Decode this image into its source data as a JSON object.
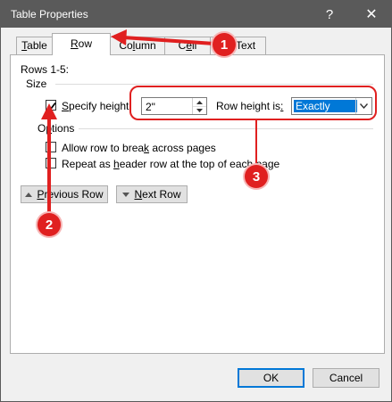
{
  "window": {
    "title": "Table Properties",
    "help_glyph": "?",
    "close_glyph": "✕"
  },
  "tabs": [
    {
      "label": "Table",
      "underline_index": 0
    },
    {
      "label": "Row",
      "underline_index": 0,
      "active": true
    },
    {
      "label": "Column",
      "underline_index": 2
    },
    {
      "label": "Cell",
      "underline_index": 1
    },
    {
      "label": "Alt Text",
      "underline_index": 1
    }
  ],
  "row_tab": {
    "rows_label": "Rows 1-5:",
    "size_group": "Size",
    "specify_height": {
      "label": "Specify height:",
      "checked": true,
      "underline_index": 0
    },
    "height_value": "2\"",
    "row_height_is": {
      "label": "Row height is:",
      "underline_index": 13
    },
    "row_height_mode": "Exactly",
    "options_group": {
      "label": "Options",
      "underline_index": 1
    },
    "allow_break": {
      "label": "Allow row to break across pages",
      "checked": false,
      "underline_index": 17
    },
    "repeat_header": {
      "label": "Repeat as header row at the top of each page",
      "checked": false,
      "underline_index": 10
    },
    "previous_row": {
      "label": "Previous Row",
      "underline_index": 0
    },
    "next_row": {
      "label": "Next Row",
      "underline_index": 0
    }
  },
  "footer": {
    "ok": "OK",
    "cancel": "Cancel"
  },
  "annotations": {
    "callout_1": "1",
    "callout_2": "2",
    "callout_3": "3",
    "accent_color": "#e02020"
  }
}
